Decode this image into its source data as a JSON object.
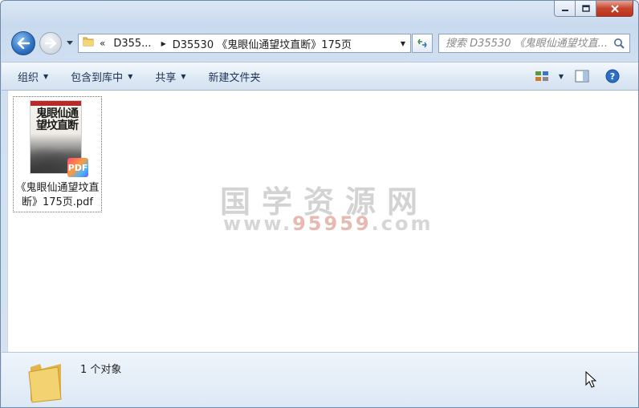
{
  "window": {
    "caption_buttons": [
      "minimize",
      "maximize",
      "close"
    ]
  },
  "address_bar": {
    "chevron": "«",
    "crumb_1": "D355...",
    "crumb_2": "D35530 《鬼眼仙通望坟直断》175页"
  },
  "search": {
    "placeholder": "搜索 D35530 《鬼眼仙通望坟直..."
  },
  "toolbar": {
    "organize": "组织",
    "include_in_library": "包含到库中",
    "share": "共享",
    "new_folder": "新建文件夹"
  },
  "file": {
    "name": "《鬼眼仙通望坟直断》175页.pdf",
    "thumbnail_title": "鬼眼仙通望坟直断",
    "badge": "PDF"
  },
  "watermark": {
    "text_cn": "国学资源网",
    "url_prefix": "www.",
    "url_number": "95959",
    "url_suffix": ".com"
  },
  "details": {
    "count": "1 个对象"
  },
  "colors": {
    "accent": "#2d6fc0",
    "close_red": "#c7452d",
    "toolbar_text": "#1e3355"
  }
}
